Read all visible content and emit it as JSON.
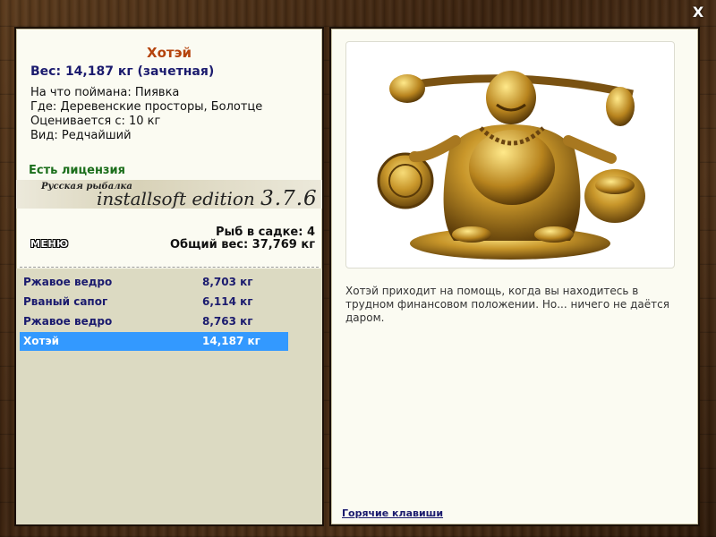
{
  "close": {
    "label": "X"
  },
  "fish": {
    "name": "Хотэй",
    "weight_line": "Вес: 14,187 кг (зачетная)",
    "caught_on": "На что поймана: Пиявка",
    "location": "Где: Деревенские просторы, Болотце",
    "valued_from": "Оценивается с: 10 кг",
    "kind": "Вид: Редчайший"
  },
  "license": "Есть лицензия",
  "banner": {
    "small": "Русская рыбалка",
    "edition": "installsoft edition",
    "version": "3.7.6"
  },
  "stats": {
    "count": "Рыб в садке: 4",
    "total": "Общий вес: 37,769 кг"
  },
  "menu": {
    "label": "МЕНЮ"
  },
  "catch_list": [
    {
      "name": "Ржавое ведро",
      "weight": "8,703 кг"
    },
    {
      "name": "Рваный сапог",
      "weight": "6,114 кг"
    },
    {
      "name": "Ржавое ведро",
      "weight": "8,763 кг"
    },
    {
      "name": "Хотэй",
      "weight": "14,187 кг"
    }
  ],
  "description": "Хотэй приходит на помощь, когда вы находитесь в трудном финансовом положении. Но... ничего не даётся даром.",
  "hotkeys": "Горячие клавиши",
  "colors": {
    "title": "#b5440d",
    "accent_text": "#1b1b6e",
    "license": "#1b6e1b",
    "selected_row": "#3399ff"
  }
}
